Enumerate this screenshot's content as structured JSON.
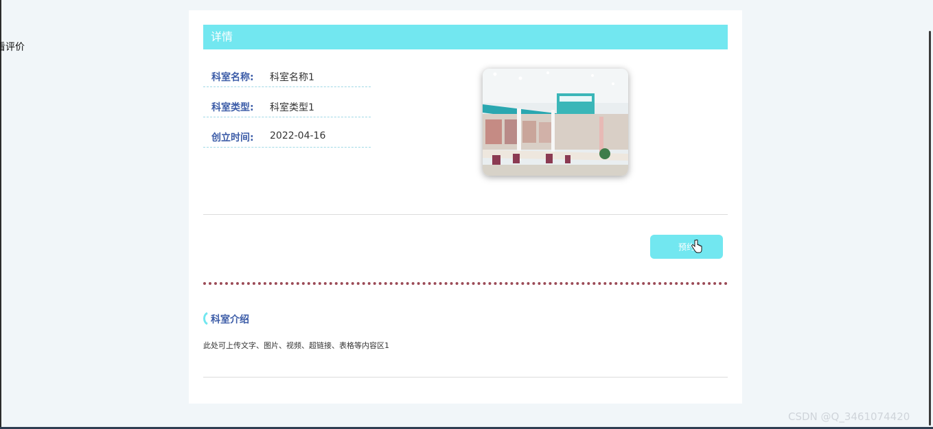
{
  "side_label": "看评价",
  "header": {
    "title": "详情"
  },
  "fields": [
    {
      "label": "科室名称:",
      "value": "科室名称1"
    },
    {
      "label": "科室类型:",
      "value": "科室类型1"
    },
    {
      "label": "创立时间:",
      "value": "2022-04-16"
    }
  ],
  "preview_button": {
    "label": "预约"
  },
  "intro": {
    "title": "科室介绍",
    "text": "此处可上传文字、图片、视频、超链接、表格等内容区1"
  },
  "watermark": "CSDN @Q_3461074420",
  "icons": {
    "cursor": "hand-pointer-icon",
    "title_marker": "bracket-icon"
  },
  "colors": {
    "accent": "#72e7f0",
    "label_blue": "#3d5da8",
    "dotted_line": "#9b4b57"
  }
}
